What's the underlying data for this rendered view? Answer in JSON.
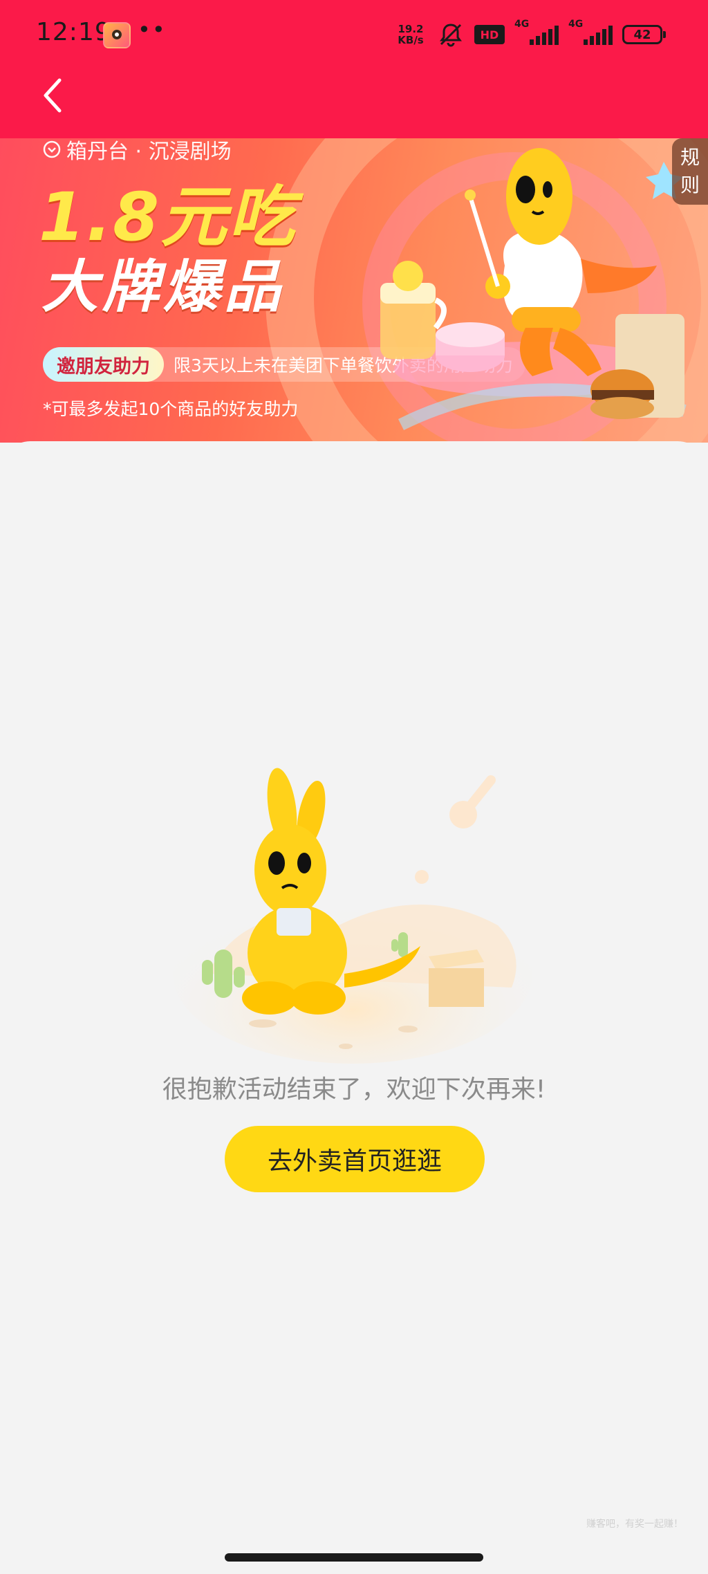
{
  "status_bar": {
    "time": "12:19",
    "dots": "••",
    "net_speed_value": "19.2",
    "net_speed_unit": "KB/s",
    "hd_label": "HD",
    "signal1_label": "4G",
    "signal2_label": "4G",
    "battery": "42"
  },
  "banner": {
    "location": "箱丹台 · 沉浸剧场",
    "headline": "1.8元吃",
    "subheadline": "大牌爆品",
    "invite_tag": "邀朋友助力",
    "invite_desc": "限3天以上未在美团下单餐饮外卖的用户助力",
    "footnote": "*可最多发起10个商品的好友助力",
    "rules_label_1": "规",
    "rules_label_2": "则"
  },
  "empty_state": {
    "message": "很抱歉活动结束了，欢迎下次再来!",
    "button_label": "去外卖首页逛逛"
  },
  "watermark": "赚客吧，有奖一起赚！",
  "colors": {
    "topbar": "#fb1a49",
    "button": "#ffd814",
    "mascot": "#ffd21a",
    "page_bg": "#f3f3f3"
  }
}
